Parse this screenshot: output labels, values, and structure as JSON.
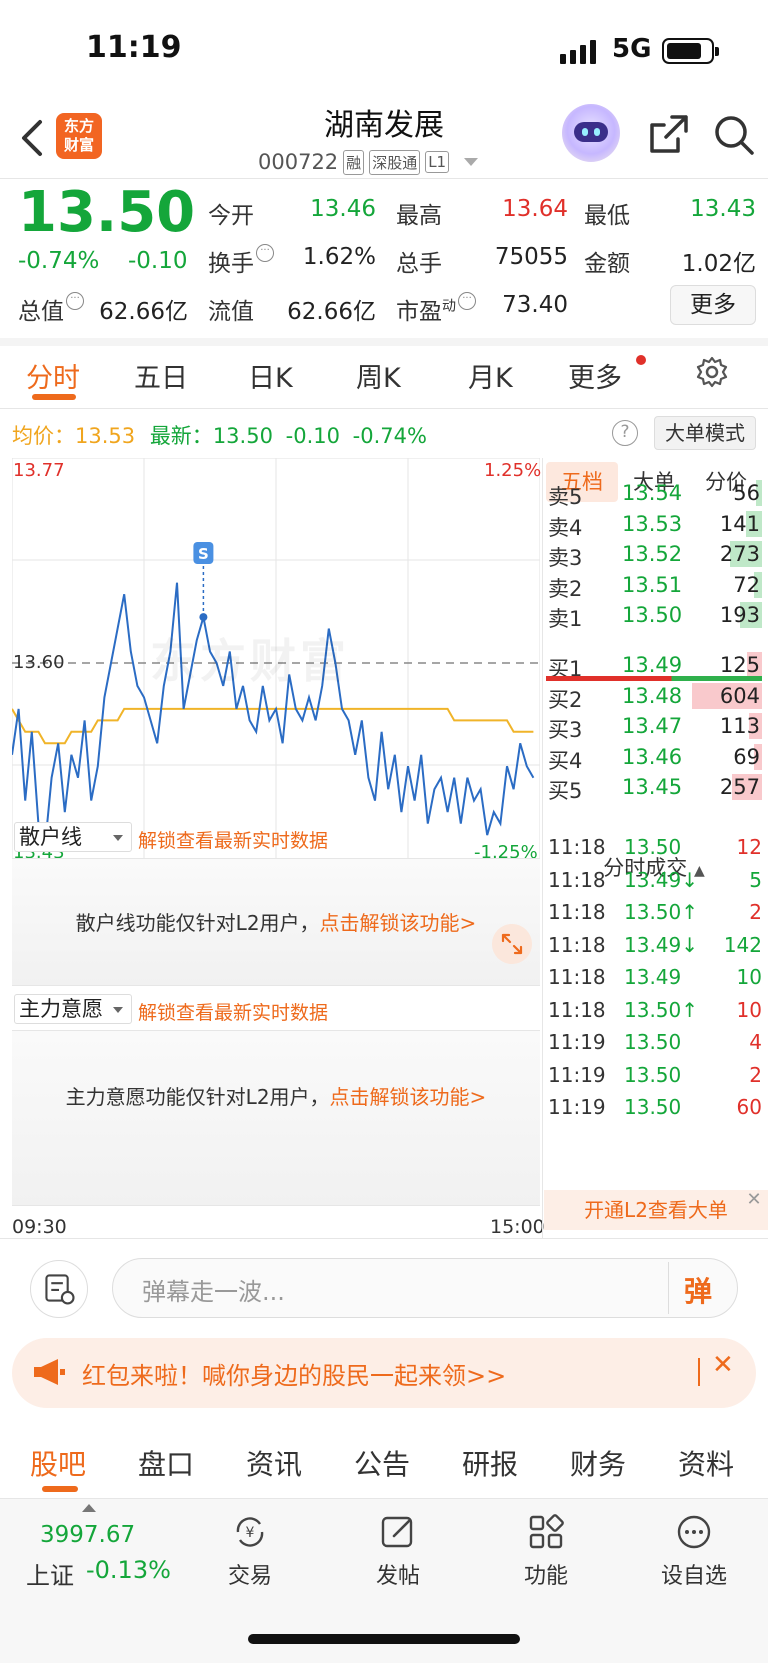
{
  "status_bar": {
    "time": "11:19",
    "network": "5G"
  },
  "header": {
    "logo_line1": "东方",
    "logo_line2": "财富",
    "stock_name": "湖南发展",
    "stock_code": "000722",
    "tags": [
      "融",
      "深股通",
      "L1"
    ]
  },
  "quote": {
    "price": "13.50",
    "pct_change": "-0.74%",
    "change": "-0.10",
    "fields": {
      "open_label": "今开",
      "open": "13.46",
      "high_label": "最高",
      "high": "13.64",
      "low_label": "最低",
      "low": "13.43",
      "turnover_rate_label": "换手",
      "turnover_rate": "1.62%",
      "volume_label": "总手",
      "volume": "75055",
      "amount_label": "金额",
      "amount": "1.02亿",
      "total_mv_label": "总值",
      "total_mv": "62.66亿",
      "float_mv_label": "流值",
      "float_mv": "62.66亿",
      "pe_label": "市盈",
      "pe_sup": "动",
      "pe": "73.40"
    },
    "more_button": "更多"
  },
  "chart_tabs": [
    "分时",
    "五日",
    "日K",
    "周K",
    "月K",
    "更多"
  ],
  "avg_info": {
    "avg_label": "均价：",
    "avg_value": "13.53",
    "latest_label": "最新：",
    "latest_value": "13.50",
    "latest_change": "-0.10",
    "latest_pct": "-0.74%",
    "help_symbol": "?",
    "big_order_mode": "大单模式"
  },
  "intraday_chart": {
    "y_top": "13.77",
    "y_mid": "13.60",
    "y_bottom": "13.43",
    "pct_top": "1.25%",
    "pct_bottom": "-1.25%",
    "watermark": "东方财富",
    "signal_marker": "S",
    "time_start": "09:30",
    "time_end": "15:00"
  },
  "chart_data": {
    "type": "line",
    "x_label": "",
    "y_label": "",
    "ylim": [
      13.43,
      13.77
    ],
    "reference_price": 13.6,
    "series": [
      {
        "name": "",
        "values": [
          13.52,
          13.56,
          13.48,
          13.54,
          13.46,
          13.44,
          13.5,
          13.53,
          13.47,
          13.52,
          13.5,
          13.55,
          13.48,
          13.51,
          13.57,
          13.6,
          13.63,
          13.66,
          13.61,
          13.58,
          13.57,
          13.55,
          13.53,
          13.58,
          13.61,
          13.67,
          13.56,
          13.59,
          13.62,
          13.64,
          13.61,
          13.6,
          13.58,
          13.61,
          13.56,
          13.58,
          13.55,
          13.54,
          13.58,
          13.55,
          13.56,
          13.53,
          13.59,
          13.56,
          13.55,
          13.57,
          13.55,
          13.58,
          13.63,
          13.6,
          13.56,
          13.55,
          13.52,
          13.55,
          13.5,
          13.48,
          13.54,
          13.49,
          13.52,
          13.47,
          13.51,
          13.48,
          13.52,
          13.46,
          13.49,
          13.5,
          13.47,
          13.5,
          13.46,
          13.5,
          13.48,
          13.49,
          13.45,
          13.47,
          13.46,
          13.51,
          13.49,
          13.53,
          13.51,
          13.5
        ]
      },
      {
        "name": "",
        "values": [
          13.56,
          13.55,
          13.54,
          13.54,
          13.54,
          13.53,
          13.53,
          13.53,
          13.53,
          13.54,
          13.54,
          13.54,
          13.54,
          13.55,
          13.55,
          13.55,
          13.55,
          13.56,
          13.56,
          13.56,
          13.56,
          13.56,
          13.56,
          13.56,
          13.56,
          13.56,
          13.56,
          13.56,
          13.56,
          13.56,
          13.56,
          13.56,
          13.56,
          13.56,
          13.56,
          13.56,
          13.56,
          13.56,
          13.56,
          13.56,
          13.56,
          13.56,
          13.56,
          13.56,
          13.56,
          13.56,
          13.56,
          13.56,
          13.56,
          13.56,
          13.56,
          13.56,
          13.56,
          13.56,
          13.56,
          13.56,
          13.56,
          13.56,
          13.56,
          13.56,
          13.56,
          13.56,
          13.56,
          13.56,
          13.56,
          13.56,
          13.56,
          13.55,
          13.55,
          13.55,
          13.55,
          13.55,
          13.55,
          13.55,
          13.55,
          13.55,
          13.54,
          13.54,
          13.54,
          13.54
        ]
      }
    ],
    "grid": true
  },
  "indicators": [
    {
      "selector": "散户线",
      "unlock_hint": "解锁查看最新实时数据",
      "message": "散户线功能仅针对L2用户，",
      "cta": "点击解锁该功能>"
    },
    {
      "selector": "主力意愿",
      "unlock_hint": "解锁查看最新实时数据",
      "message": "主力意愿功能仅针对L2用户，",
      "cta": "点击解锁该功能>"
    }
  ],
  "order_book": {
    "tabs": [
      "五档",
      "大单",
      "分价"
    ],
    "asks": [
      {
        "label": "卖5",
        "price": "13.54",
        "qty": "56",
        "level": 0.09
      },
      {
        "label": "卖4",
        "price": "13.53",
        "qty": "141",
        "level": 0.23
      },
      {
        "label": "卖3",
        "price": "13.52",
        "qty": "273",
        "level": 0.45
      },
      {
        "label": "卖2",
        "price": "13.51",
        "qty": "72",
        "level": 0.12
      },
      {
        "label": "卖1",
        "price": "13.50",
        "qty": "193",
        "level": 0.32
      }
    ],
    "bids": [
      {
        "label": "买1",
        "price": "13.49",
        "qty": "125",
        "level": 0.21
      },
      {
        "label": "买2",
        "price": "13.48",
        "qty": "604",
        "level": 1.0
      },
      {
        "label": "买3",
        "price": "13.47",
        "qty": "113",
        "level": 0.19
      },
      {
        "label": "买4",
        "price": "13.46",
        "qty": "69",
        "level": 0.11
      },
      {
        "label": "买5",
        "price": "13.45",
        "qty": "257",
        "level": 0.43
      }
    ],
    "trades_title": "分时成交",
    "trades": [
      {
        "time": "11:18",
        "price": "13.50",
        "vol": "12",
        "dir": "",
        "pc": "green",
        "vc": "red"
      },
      {
        "time": "11:18",
        "price": "13.49↓",
        "vol": "5",
        "dir": "",
        "pc": "green",
        "vc": "green"
      },
      {
        "time": "11:18",
        "price": "13.50↑",
        "vol": "2",
        "dir": "",
        "pc": "green",
        "vc": "red"
      },
      {
        "time": "11:18",
        "price": "13.49↓",
        "vol": "142",
        "dir": "",
        "pc": "green",
        "vc": "green"
      },
      {
        "time": "11:18",
        "price": "13.49",
        "vol": "10",
        "dir": "",
        "pc": "green",
        "vc": "green"
      },
      {
        "time": "11:18",
        "price": "13.50↑",
        "vol": "10",
        "dir": "",
        "pc": "green",
        "vc": "red"
      },
      {
        "time": "11:19",
        "price": "13.50",
        "vol": "4",
        "dir": "",
        "pc": "green",
        "vc": "red"
      },
      {
        "time": "11:19",
        "price": "13.50",
        "vol": "2",
        "dir": "",
        "pc": "green",
        "vc": "red"
      },
      {
        "time": "11:19",
        "price": "13.50",
        "vol": "60",
        "dir": "",
        "pc": "green",
        "vc": "red"
      }
    ],
    "l2_banner": "开通L2查看大单"
  },
  "danmaku": {
    "placeholder": "弹幕走一波...",
    "send": "弹"
  },
  "red_packet": {
    "text": "红包来啦！喊你身边的股民一起来领>>",
    "close": "✕"
  },
  "content_tabs": [
    "股吧",
    "盘口",
    "资讯",
    "公告",
    "研报",
    "财务",
    "资料"
  ],
  "bottom_bar": {
    "index_value": "3997.67",
    "index_name": "上证",
    "index_pct": "-0.13%",
    "items": [
      "交易",
      "发帖",
      "功能",
      "设自选"
    ]
  },
  "colors": {
    "up": "#e0302a",
    "down": "#14a63a",
    "accent": "#ee6a1c",
    "avg_line": "#f0b429",
    "price_line": "#2b6cc4"
  }
}
